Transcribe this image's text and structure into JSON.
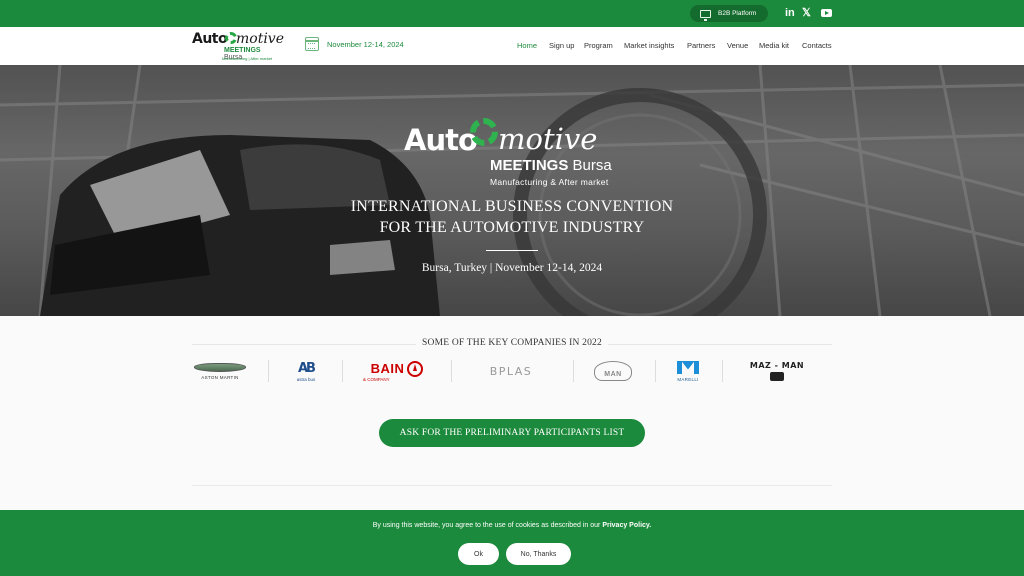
{
  "colors": {
    "brand_green": "#1c8a3c",
    "dark_green": "#146b2e",
    "white": "#ffffff"
  },
  "topbar": {
    "b2b_label": "B2B Platform",
    "b2b_icon": "monitor-icon",
    "social": [
      {
        "name": "linkedin-icon",
        "glyph": "in"
      },
      {
        "name": "x-twitter-icon",
        "glyph": "𝕏"
      },
      {
        "name": "youtube-icon",
        "glyph": ""
      }
    ]
  },
  "header": {
    "logo": {
      "auto": "Auto",
      "motive": "motive",
      "meetings": "MEETINGS",
      "bursa": "Bursa",
      "tagline": "Manufacturing | After market"
    },
    "date": "November 12-14, 2024",
    "nav": [
      {
        "label": "Home",
        "active": true
      },
      {
        "label": "Sign up"
      },
      {
        "label": "Program"
      },
      {
        "label": "Market insights"
      },
      {
        "label": "Partners"
      },
      {
        "label": "Venue"
      },
      {
        "label": "Media kit"
      },
      {
        "label": "Contacts"
      }
    ]
  },
  "hero": {
    "logo": {
      "auto": "Auto",
      "motive": "motive",
      "meetings": "MEETINGS",
      "bursa": "Bursa",
      "tagline": "Manufacturing & After market"
    },
    "title_line1": "INTERNATIONAL BUSINESS CONVENTION",
    "title_line2": "FOR THE AUTOMOTIVE INDUSTRY",
    "place_date": "Bursa, Turkey | November 12-14, 2024"
  },
  "companies": {
    "heading": "SOME OF THE KEY COMPANIES IN 2022",
    "logos": {
      "aston_martin": "ASTON MARTIN",
      "astra_bus_mark": "AB",
      "astra_bus": "astra bus",
      "bain_word": "BAIN",
      "bain_sub": "& COMPANY",
      "bplas": "BPLAS",
      "man": "MAN",
      "marelli": "MARELLI",
      "maz_man": "MAZ - MAN"
    }
  },
  "cta": {
    "label": "ASK FOR THE PRELIMINARY PARTICIPANTS LIST"
  },
  "cookie": {
    "text": "By using this website, you agree to the use of cookies as described in our ",
    "link": "Privacy Policy.",
    "ok": "Ok",
    "no": "No, Thanks"
  }
}
